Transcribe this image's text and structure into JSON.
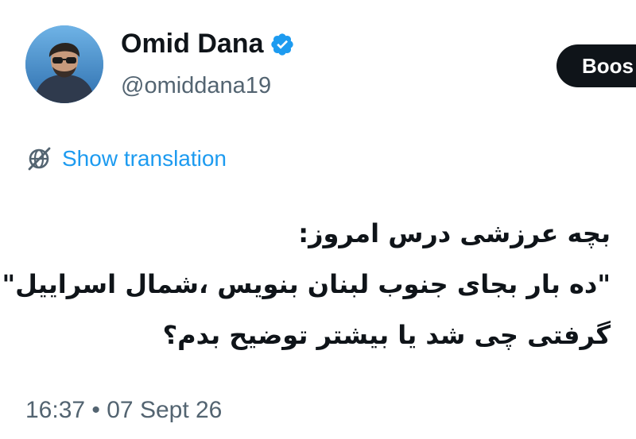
{
  "author": {
    "display_name": "Omid Dana",
    "handle": "@omiddana19",
    "verified": true,
    "verified_color": "#1d9bf0"
  },
  "header": {
    "boost_label": "Boos"
  },
  "translation": {
    "label": "Show translation",
    "icon": "globe-slash-icon",
    "color": "#1d9bf0"
  },
  "tweet": {
    "lines": [
      "بچه عرزشی درس امروز:",
      "\"ده بار بجای جنوب لبنان بنویس ،شمال اسراییل\"",
      "گرفتی چی شد یا بیشتر توضیح بدم؟"
    ],
    "timestamp": "16:37 • 07 Sept 26"
  }
}
